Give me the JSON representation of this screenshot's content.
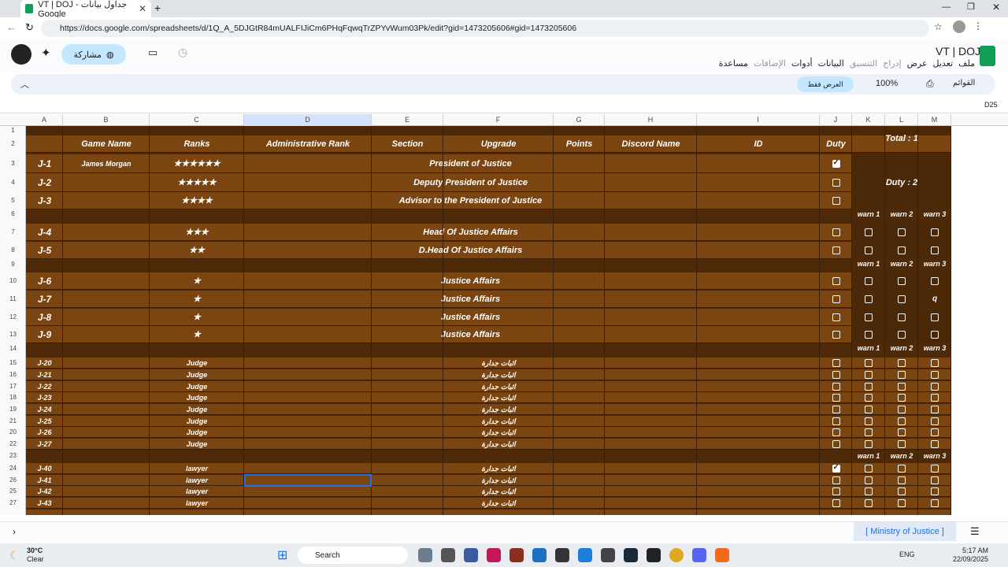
{
  "browser": {
    "tab_title": "VT | DOJ - جداول بيانات Google",
    "url": "https://docs.google.com/spreadsheets/d/1Q_A_5DJGtR84mUALFIJiCm6PHqFqwqTrZPYvWum03Pk/edit?gid=1473205606#gid=1473205606"
  },
  "doc": {
    "title": "VT | DOJ",
    "menus": [
      "ملف",
      "تعديل",
      "عرض",
      "إدراج",
      "التنسيق",
      "البيانات",
      "أدوات",
      "الإضافات",
      "مساعدة"
    ],
    "share": "مشاركة",
    "view_only": "العرض فقط",
    "zoom": "100%",
    "menus_search": "القوائم",
    "cell_ref": "D25"
  },
  "columns": [
    "A",
    "B",
    "C",
    "D",
    "E",
    "F",
    "G",
    "H",
    "I",
    "J",
    "K",
    "L",
    "M"
  ],
  "headers": {
    "game": "Game Name",
    "ranks": "Ranks",
    "admin": "Administrative Rank",
    "section": "Section",
    "upgrade": "Upgrade",
    "points": "Points",
    "discord": "Discord Name",
    "id": "ID",
    "duty": "Duty",
    "total": "Total : 1",
    "duty_count": "Duty : 2",
    "warn1": "warn 1",
    "warn2": "warn 2",
    "warn3": "warn 3"
  },
  "rows": [
    {
      "n": "3",
      "code": "J-1",
      "game": "James Morgan",
      "rank": "★★★★★★",
      "title": "President of Justice",
      "duty": true
    },
    {
      "n": "4",
      "code": "J-2",
      "game": "",
      "rank": "★★★★★",
      "title": "Deputy President of Justice",
      "duty": false
    },
    {
      "n": "5",
      "code": "J-3",
      "game": "",
      "rank": "★★★★",
      "title": "Advisor to the President of Justice",
      "duty": false
    },
    {
      "n": "7",
      "code": "J-4",
      "game": "",
      "rank": "★★★",
      "title": "Head Of Justice Affairs",
      "duty": false
    },
    {
      "n": "8",
      "code": "J-5",
      "game": "",
      "rank": "★★",
      "title": "D.Head Of Justice Affairs",
      "duty": false
    },
    {
      "n": "10",
      "code": "J-6",
      "game": "",
      "rank": "★",
      "title": "Justice Affairs",
      "duty": false
    },
    {
      "n": "11",
      "code": "J-7",
      "game": "",
      "rank": "★",
      "title": "Justice Affairs",
      "duty": false,
      "w3": "q"
    },
    {
      "n": "12",
      "code": "J-8",
      "game": "",
      "rank": "★",
      "title": "Justice Affairs",
      "duty": false
    },
    {
      "n": "13",
      "code": "J-9",
      "game": "",
      "rank": "★",
      "title": "Justice Affairs",
      "duty": false
    }
  ],
  "judges": [
    {
      "n": "15",
      "code": "J-20",
      "rank": "Judge",
      "upgrade": "اثبات جدارة"
    },
    {
      "n": "16",
      "code": "J-21",
      "rank": "Judge",
      "upgrade": "اثبات جدارة"
    },
    {
      "n": "17",
      "code": "J-22",
      "rank": "Judge",
      "upgrade": "اثبات جدارة"
    },
    {
      "n": "18",
      "code": "J-23",
      "rank": "Judge",
      "upgrade": "اثبات جدارة"
    },
    {
      "n": "19",
      "code": "J-24",
      "rank": "Judge",
      "upgrade": "اثبات جدارة"
    },
    {
      "n": "21",
      "code": "J-25",
      "rank": "Judge",
      "upgrade": "اثبات جدارة"
    },
    {
      "n": "20",
      "code": "J-26",
      "rank": "Judge",
      "upgrade": "اثبات جدارة"
    },
    {
      "n": "22",
      "code": "J-27",
      "rank": "Judge",
      "upgrade": "اثبات جدارة"
    }
  ],
  "lawyers": [
    {
      "n": "24",
      "code": "J-40",
      "rank": "lawyer",
      "upgrade": "اثبات جدارة",
      "duty": true
    },
    {
      "n": "26",
      "code": "J-41",
      "rank": "lawyer",
      "upgrade": "اثبات جدارة",
      "duty": false
    },
    {
      "n": "25",
      "code": "J-42",
      "rank": "lawyer",
      "upgrade": "اثبات جدارة",
      "duty": false
    },
    {
      "n": "27",
      "code": "J-43",
      "rank": "lawyer",
      "upgrade": "اثبات جدارة",
      "duty": false
    }
  ],
  "sheet_tab": "[ Ministry of Justice ]",
  "taskbar": {
    "weather_temp": "30°C",
    "weather_desc": "Clear",
    "search": "Search",
    "lang": "ENG",
    "time": "5:17 AM",
    "date": "22/09/2025"
  },
  "colors": {
    "band": "#7a4511",
    "dark": "#4a2808",
    "accent": "#1a73e8"
  }
}
